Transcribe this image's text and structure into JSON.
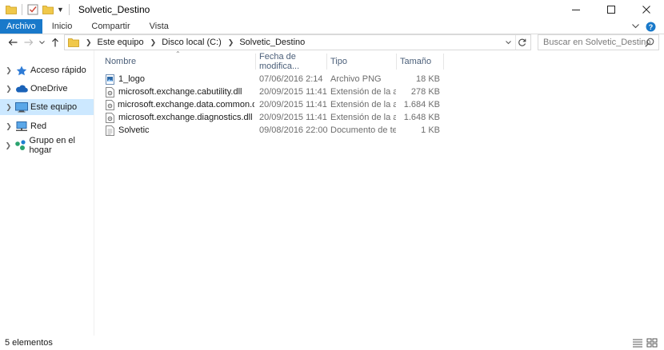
{
  "window": {
    "title": "Solvetic_Destino",
    "controls": [
      "minimize-icon",
      "maximize-icon",
      "close-icon"
    ]
  },
  "ribbon": {
    "tabs": [
      "Archivo",
      "Inicio",
      "Compartir",
      "Vista"
    ],
    "accent_color": "#1979ca"
  },
  "address": {
    "breadcrumb": [
      "Este equipo",
      "Disco local (C:)",
      "Solvetic_Destino"
    ],
    "search_placeholder": "Buscar en Solvetic_Destino"
  },
  "nav_pane": {
    "items": [
      {
        "label": "Acceso rápido",
        "icon": "star-icon",
        "selected": false
      },
      {
        "label": "OneDrive",
        "icon": "cloud-icon",
        "selected": false
      },
      {
        "label": "Este equipo",
        "icon": "computer-icon",
        "selected": true
      },
      {
        "label": "Red",
        "icon": "network-icon",
        "selected": false
      },
      {
        "label": "Grupo en el hogar",
        "icon": "homegroup-icon",
        "selected": false
      }
    ],
    "selected_color": "#cce8ff"
  },
  "file_list": {
    "columns": [
      "Nombre",
      "Fecha de modifica...",
      "Tipo",
      "Tamaño"
    ],
    "rows": [
      {
        "name": "1_logo",
        "date": "07/06/2016 2:14",
        "type": "Archivo PNG",
        "size": "18 KB",
        "icon": "image-file-icon"
      },
      {
        "name": "microsoft.exchange.cabutility.dll",
        "date": "20/09/2015 11:41",
        "type": "Extensión de la apl...",
        "size": "278 KB",
        "icon": "dll-file-icon"
      },
      {
        "name": "microsoft.exchange.data.common.dll",
        "date": "20/09/2015 11:41",
        "type": "Extensión de la apl...",
        "size": "1.684 KB",
        "icon": "dll-file-icon"
      },
      {
        "name": "microsoft.exchange.diagnostics.dll",
        "date": "20/09/2015 11:41",
        "type": "Extensión de la apl...",
        "size": "1.648 KB",
        "icon": "dll-file-icon"
      },
      {
        "name": "Solvetic",
        "date": "09/08/2016 22:00",
        "type": "Documento de tex...",
        "size": "1 KB",
        "icon": "text-file-icon"
      }
    ]
  },
  "status": {
    "count_text": "5 elementos"
  }
}
